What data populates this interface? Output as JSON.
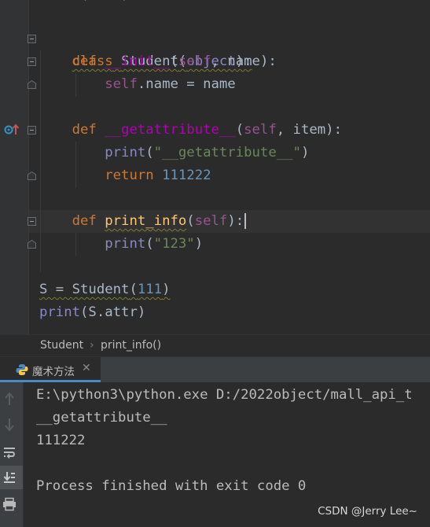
{
  "editor": {
    "line_top_partial": "def  (self):",
    "line_class": {
      "kw": "class",
      "name": "Student",
      "open": "(",
      "base": "object",
      "close": "):"
    },
    "line_init_def": {
      "kw": "def",
      "name": "__init__",
      "open": "(",
      "self": "self",
      "rest": ", name):"
    },
    "line_init_body": {
      "self": "self",
      "rest": ".name = name"
    },
    "line_ga_def": {
      "kw": "def",
      "name": "__getattribute__",
      "open": "(",
      "self": "self",
      "rest": ", item):"
    },
    "line_ga_print": {
      "fn": "print",
      "open": "(",
      "str": "\"__getattribute__\"",
      "close": ")"
    },
    "line_ga_return": {
      "kw": "return",
      "num": "111222"
    },
    "line_pi_def": {
      "kw": "def",
      "name": "print_info",
      "open": "(",
      "self": "self",
      "close": "):"
    },
    "line_pi_print": {
      "fn": "print",
      "open": "(",
      "str": "\"123\"",
      "close": ")"
    },
    "line_s_assign": {
      "var": "S = ",
      "cls": "Student",
      "open": "(",
      "num": "111",
      "close": ")"
    },
    "line_print_attr": {
      "fn": "print",
      "rest": "(S.attr)"
    }
  },
  "breadcrumb": {
    "items": [
      "Student",
      "print_info()"
    ],
    "separator": "›"
  },
  "run_panel": {
    "tab_label": "魔术方法",
    "console_lines": [
      "E:\\python3\\python.exe D:/2022object/mall_api_t",
      "__getattribute__",
      "111222",
      "",
      "Process finished with exit code 0"
    ]
  },
  "watermark": "CSDN @Jerry Lee~",
  "icons": {
    "gutter_override": "override-up-arrow-icon",
    "tab": "python-file-icon",
    "close": "close-icon",
    "toolbar": [
      "rerun-up-icon",
      "down-arrow-icon",
      "soft-wrap-icon",
      "scroll-to-end-icon",
      "print-icon"
    ]
  },
  "colors": {
    "editor_bg": "#2b2b2b",
    "gutter_bg": "#313335",
    "keyword": "#cc7832",
    "function": "#ffc66d",
    "self": "#94558d",
    "number": "#6897bb",
    "string": "#6a8759",
    "builtin": "#8888c6",
    "text": "#a9b7c6",
    "tab_underline": "#4a88c7"
  }
}
